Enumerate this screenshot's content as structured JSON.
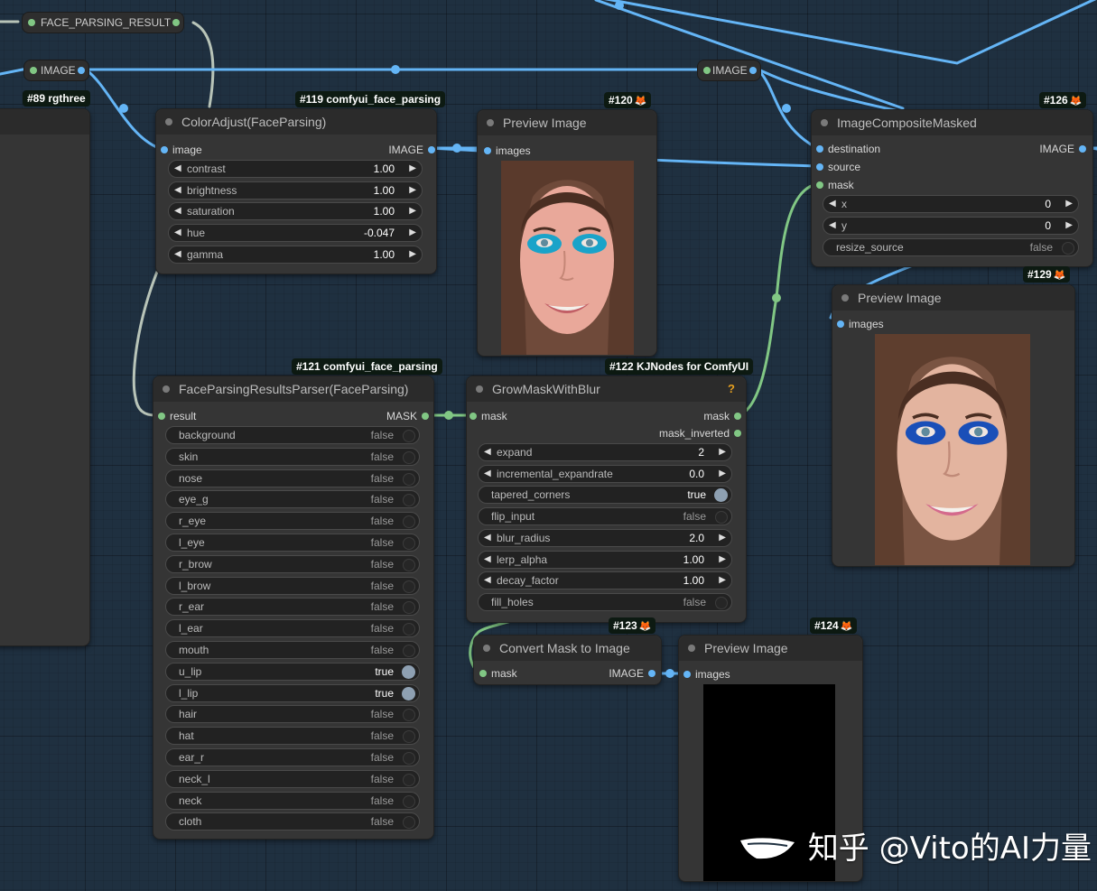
{
  "reroutes": {
    "face_parsing_result": "FACE_PARSING_RESULT",
    "image_left": "IMAGE",
    "image_right": "IMAGE"
  },
  "node_89": {
    "badge": "#89 rgthree"
  },
  "node_119": {
    "badge": "#119 comfyui_face_parsing",
    "title": "ColorAdjust(FaceParsing)",
    "input": "image",
    "output": "IMAGE",
    "widgets": [
      {
        "label": "contrast",
        "value": "1.00"
      },
      {
        "label": "brightness",
        "value": "1.00"
      },
      {
        "label": "saturation",
        "value": "1.00"
      },
      {
        "label": "hue",
        "value": "-0.047"
      },
      {
        "label": "gamma",
        "value": "1.00"
      }
    ]
  },
  "node_120": {
    "badge": "#120",
    "title": "Preview Image",
    "input": "images"
  },
  "node_126": {
    "badge": "#126",
    "title": "ImageCompositeMasked",
    "inputs": [
      "destination",
      "source",
      "mask"
    ],
    "output": "IMAGE",
    "widgets": [
      {
        "label": "x",
        "value": "0"
      },
      {
        "label": "y",
        "value": "0"
      }
    ],
    "toggle": {
      "label": "resize_source",
      "value": "false"
    }
  },
  "node_129": {
    "badge": "#129",
    "title": "Preview Image",
    "input": "images"
  },
  "node_121": {
    "badge": "#121 comfyui_face_parsing",
    "title": "FaceParsingResultsParser(FaceParsing)",
    "input": "result",
    "output": "MASK",
    "toggles": [
      {
        "label": "background",
        "value": "false",
        "on": false
      },
      {
        "label": "skin",
        "value": "false",
        "on": false
      },
      {
        "label": "nose",
        "value": "false",
        "on": false
      },
      {
        "label": "eye_g",
        "value": "false",
        "on": false
      },
      {
        "label": "r_eye",
        "value": "false",
        "on": false
      },
      {
        "label": "l_eye",
        "value": "false",
        "on": false
      },
      {
        "label": "r_brow",
        "value": "false",
        "on": false
      },
      {
        "label": "l_brow",
        "value": "false",
        "on": false
      },
      {
        "label": "r_ear",
        "value": "false",
        "on": false
      },
      {
        "label": "l_ear",
        "value": "false",
        "on": false
      },
      {
        "label": "mouth",
        "value": "false",
        "on": false
      },
      {
        "label": "u_lip",
        "value": "true",
        "on": true
      },
      {
        "label": "l_lip",
        "value": "true",
        "on": true
      },
      {
        "label": "hair",
        "value": "false",
        "on": false
      },
      {
        "label": "hat",
        "value": "false",
        "on": false
      },
      {
        "label": "ear_r",
        "value": "false",
        "on": false
      },
      {
        "label": "neck_l",
        "value": "false",
        "on": false
      },
      {
        "label": "neck",
        "value": "false",
        "on": false
      },
      {
        "label": "cloth",
        "value": "false",
        "on": false
      }
    ]
  },
  "node_122": {
    "badge": "#122 KJNodes for ComfyUI",
    "title": "GrowMaskWithBlur",
    "help": "?",
    "input": "mask",
    "outputs": [
      "mask",
      "mask_inverted"
    ],
    "widgets": [
      {
        "kind": "num",
        "label": "expand",
        "value": "2"
      },
      {
        "kind": "num",
        "label": "incremental_expandrate",
        "value": "0.0"
      },
      {
        "kind": "tog",
        "label": "tapered_corners",
        "value": "true",
        "on": true
      },
      {
        "kind": "tog",
        "label": "flip_input",
        "value": "false",
        "on": false
      },
      {
        "kind": "num",
        "label": "blur_radius",
        "value": "2.0"
      },
      {
        "kind": "num",
        "label": "lerp_alpha",
        "value": "1.00"
      },
      {
        "kind": "num",
        "label": "decay_factor",
        "value": "1.00"
      },
      {
        "kind": "tog",
        "label": "fill_holes",
        "value": "false",
        "on": false
      }
    ]
  },
  "node_123": {
    "badge": "#123",
    "title": "Convert Mask to Image",
    "input": "mask",
    "output": "IMAGE"
  },
  "node_124": {
    "badge": "#124",
    "title": "Preview Image",
    "input": "images"
  },
  "watermark": "知乎 @Vito的AI力量",
  "colors": {
    "canvas": "#1f3040",
    "image_link": "#64b5f6",
    "mask_link": "#81c784",
    "result_link": "#b8c4b8",
    "node_bg": "#353535",
    "node_title_bg": "#2b2b2b"
  }
}
